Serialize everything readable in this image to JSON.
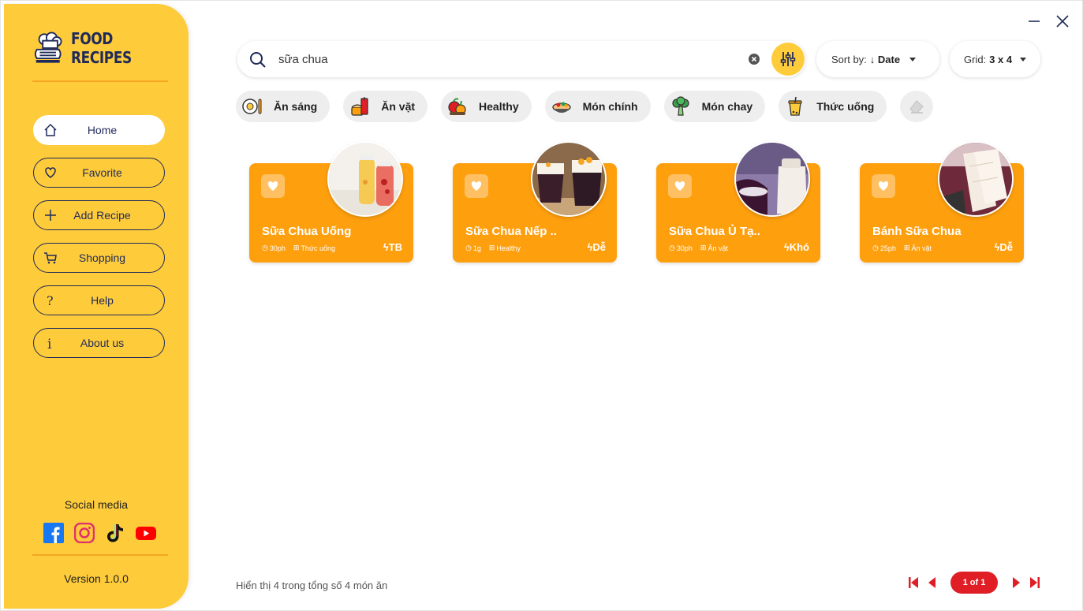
{
  "brand": {
    "name": "FOOD RECIPES"
  },
  "nav": [
    {
      "label": "Home",
      "icon": "home-icon",
      "active": true
    },
    {
      "label": "Favorite",
      "icon": "heart-icon"
    },
    {
      "label": "Add Recipe",
      "icon": "plus-icon"
    },
    {
      "label": "Shopping",
      "icon": "cart-icon"
    },
    {
      "label": "Help",
      "icon": "question-icon"
    },
    {
      "label": "About us",
      "icon": "info-icon"
    }
  ],
  "social": {
    "title": "Social media",
    "items": [
      "facebook-icon",
      "instagram-icon",
      "tiktok-icon",
      "youtube-icon"
    ]
  },
  "version": "Version 1.0.0",
  "search": {
    "value": "sữa chua",
    "placeholder": ""
  },
  "sort": {
    "label": "Sort by:",
    "value": "↓ Date"
  },
  "grid": {
    "label": "Grid:",
    "value": "3 x 4"
  },
  "categories": [
    "Ăn sáng",
    "Ăn vặt",
    "Healthy",
    "Món chính",
    "Món chay",
    "Thức uống"
  ],
  "recipes": [
    {
      "title": "Sữa Chua Uống",
      "time": "30ph",
      "category": "Thức uống",
      "difficulty": "TB"
    },
    {
      "title": "Sữa Chua Nếp ..",
      "time": "1g",
      "category": "Healthy",
      "difficulty": "Dễ"
    },
    {
      "title": "Sữa Chua Ủ Tạ..",
      "time": "30ph",
      "category": "Ăn vặt",
      "difficulty": "Khó"
    },
    {
      "title": "Bánh Sữa Chua",
      "time": "25ph",
      "category": "Ăn vặt",
      "difficulty": "Dễ"
    }
  ],
  "footer": {
    "summary": "Hiển thị 4 trong tổng số 4 món ăn",
    "page": "1 of 1"
  },
  "colors": {
    "sidebar": "#fecb3a",
    "card": "#fe9f0e",
    "accent": "#f5a623",
    "navy": "#1f2a5a",
    "pager": "#e01e26"
  }
}
